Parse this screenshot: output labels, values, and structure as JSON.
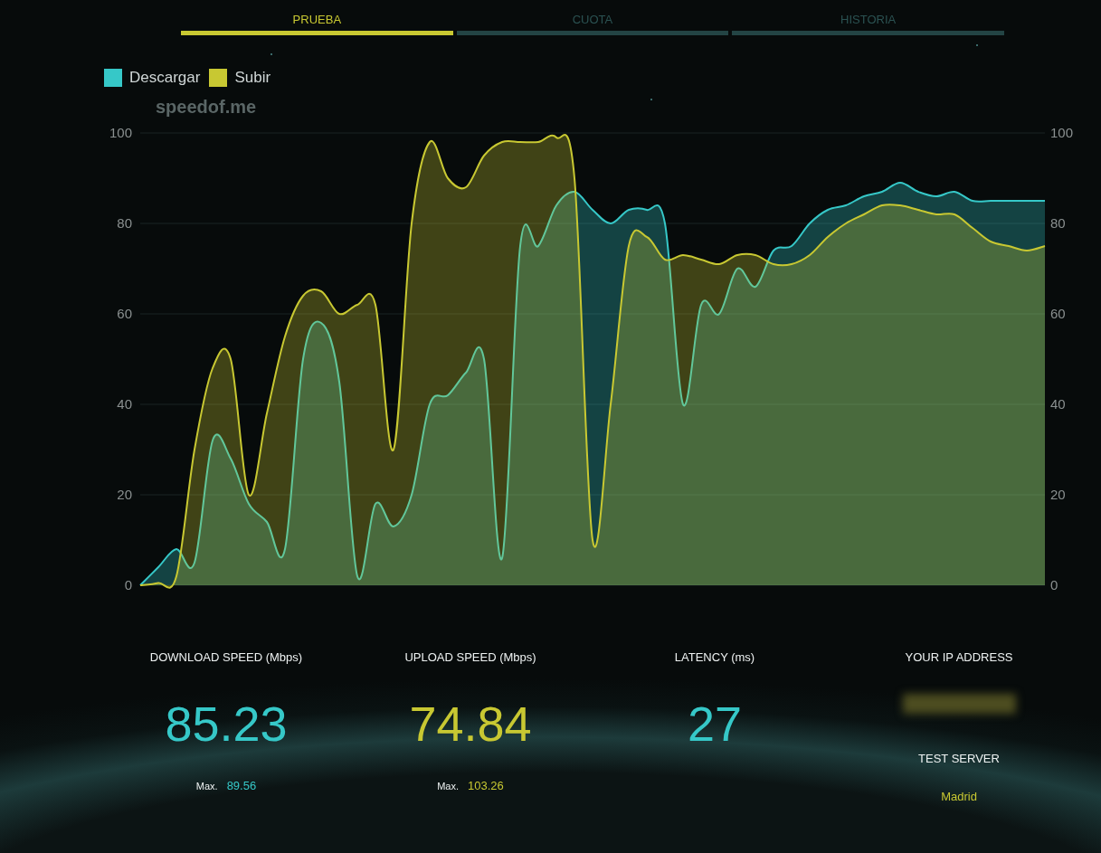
{
  "tabs": [
    {
      "label": "PRUEBA",
      "selected": true
    },
    {
      "label": "CUOTA",
      "selected": false
    },
    {
      "label": "HISTORIA",
      "selected": false
    }
  ],
  "logo": "speedof.me",
  "right_axis": {
    "ticks": [
      "100",
      "80",
      "60",
      "40",
      "20",
      "0"
    ]
  },
  "chart_data": {
    "type": "area",
    "grid": true,
    "ylim": [
      0,
      100
    ],
    "yticks": [
      0,
      20,
      40,
      60,
      80,
      100
    ],
    "series": [
      {
        "name": "Descargar",
        "color": "#36c8c8",
        "values": [
          0,
          4,
          8,
          5,
          32,
          28,
          18,
          14,
          8,
          50,
          58,
          45,
          2,
          18,
          13,
          20,
          40,
          42,
          47,
          50,
          6,
          75,
          75,
          84,
          87,
          83,
          80,
          83,
          83,
          80,
          40,
          62,
          60,
          70,
          66,
          74,
          75,
          80,
          83,
          84,
          86,
          87,
          89,
          87,
          86,
          87,
          85,
          85,
          85,
          85,
          85
        ]
      },
      {
        "name": "Subir",
        "color": "#c8c832",
        "values": [
          0,
          0.5,
          2,
          30,
          48,
          50,
          20,
          38,
          55,
          64,
          65,
          60,
          62,
          62,
          30,
          80,
          98,
          90,
          88,
          95,
          98,
          98,
          98,
          99,
          90,
          10,
          40,
          75,
          77,
          72,
          73,
          72,
          71,
          73,
          73,
          71,
          71,
          73,
          77,
          80,
          82,
          84,
          84,
          83,
          82,
          82,
          79,
          76,
          75,
          74,
          75
        ]
      }
    ]
  },
  "stats": [
    {
      "label": "DOWNLOAD SPEED (Mbps)",
      "value": "85.23",
      "color": "#36c8c8",
      "max_label": "Max.",
      "max_value": "89.56"
    },
    {
      "label": "UPLOAD SPEED (Mbps)",
      "value": "74.84",
      "color": "#c8c832",
      "max_label": "Max.",
      "max_value": "103.26"
    },
    {
      "label": "LATENCY (ms)",
      "value": "27",
      "color": "#36c8c8"
    }
  ],
  "ip": {
    "label": "YOUR IP ADDRESS",
    "server_label": "TEST SERVER",
    "server": "Madrid"
  }
}
